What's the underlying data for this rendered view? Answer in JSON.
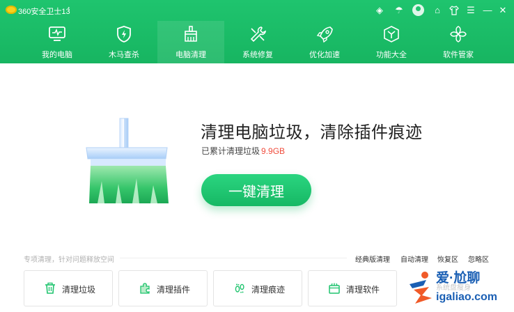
{
  "window": {
    "app_title": "360安全卫士13",
    "update_arrow": "↑",
    "title_icons": [
      "shield-icon",
      "weather-icon",
      "avatar",
      "skin-icon",
      "shirt-icon",
      "menu-icon",
      "minimize-icon",
      "close-icon"
    ],
    "glyphs": {
      "shield": "◈",
      "weather": "☂",
      "skin": "⌂",
      "shirt": "👕",
      "menu": "☰",
      "minimize": "—",
      "close": "✕"
    }
  },
  "nav": {
    "items": [
      {
        "label": "我的电脑",
        "icon": "monitor-icon"
      },
      {
        "label": "木马查杀",
        "icon": "shield-bolt-icon"
      },
      {
        "label": "电脑清理",
        "icon": "broom-icon",
        "active": true
      },
      {
        "label": "系统修复",
        "icon": "wrench-icon"
      },
      {
        "label": "优化加速",
        "icon": "rocket-icon"
      },
      {
        "label": "功能大全",
        "icon": "cube-icon"
      },
      {
        "label": "软件管家",
        "icon": "flower-icon"
      }
    ]
  },
  "hero": {
    "title": "清理电脑垃圾，清除插件痕迹",
    "subtitle_prefix": "已累计清理垃圾",
    "subtitle_amount": "9.9GB",
    "button_label": "一键清理"
  },
  "section": {
    "label": "专项清理，针对问题释放空间",
    "links": [
      "经典版清理",
      "自动清理",
      "恢复区",
      "忽略区"
    ]
  },
  "tools": [
    {
      "label": "清理垃圾",
      "icon": "trash-icon"
    },
    {
      "label": "清理插件",
      "icon": "puzzle-icon"
    },
    {
      "label": "清理痕迹",
      "icon": "footprint-icon"
    },
    {
      "label": "清理软件",
      "icon": "software-box-icon"
    }
  ],
  "watermark": {
    "line1": "爱·尬聊",
    "line2": "igaliao.com",
    "faded": "系统盘瘦身"
  },
  "colors": {
    "brand_green": "#1fc46e",
    "accent_red": "#f04c3c"
  }
}
